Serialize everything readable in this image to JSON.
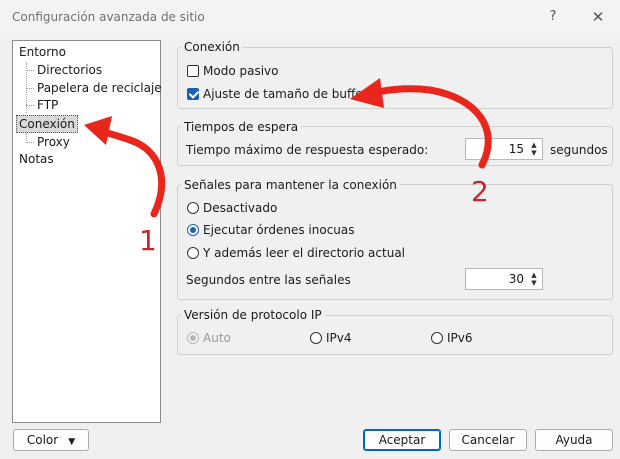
{
  "window": {
    "title": "Configuración avanzada de sitio",
    "help_glyph": "?",
    "close_glyph": "✕"
  },
  "tree": {
    "items": [
      {
        "label": "Entorno",
        "level": 0
      },
      {
        "label": "Directorios",
        "level": 1
      },
      {
        "label": "Papelera de reciclaje",
        "level": 1
      },
      {
        "label": "FTP",
        "level": 1
      },
      {
        "label": "Conexión",
        "level": 0,
        "selected": true
      },
      {
        "label": "Proxy",
        "level": 1
      },
      {
        "label": "Notas",
        "level": 0
      }
    ]
  },
  "conexion": {
    "title": "Conexión",
    "passive_label": "Modo pasivo",
    "passive_checked": false,
    "buffer_label": "Ajuste de tamaño de buffer",
    "buffer_checked": true
  },
  "timeouts": {
    "title": "Tiempos de espera",
    "label": "Tiempo máximo de respuesta esperado:",
    "value": "15",
    "unit": "segundos"
  },
  "keepalive": {
    "title": "Señales para mantener la conexión",
    "options": [
      "Desactivado",
      "Ejecutar órdenes inocuas",
      "Y además leer el directorio actual"
    ],
    "selected": "Ejecutar órdenes inocuas",
    "interval_label": "Segundos entre las señales",
    "interval_value": "30"
  },
  "ip": {
    "title": "Versión de protocolo IP",
    "options": [
      "Auto",
      "IPv4",
      "IPv6"
    ]
  },
  "buttons": {
    "color": "Color",
    "accept": "Aceptar",
    "cancel": "Cancelar",
    "help": "Ayuda"
  },
  "annotations": {
    "marker1": "1",
    "marker2": "2",
    "arrow_color": "#e8261c"
  }
}
